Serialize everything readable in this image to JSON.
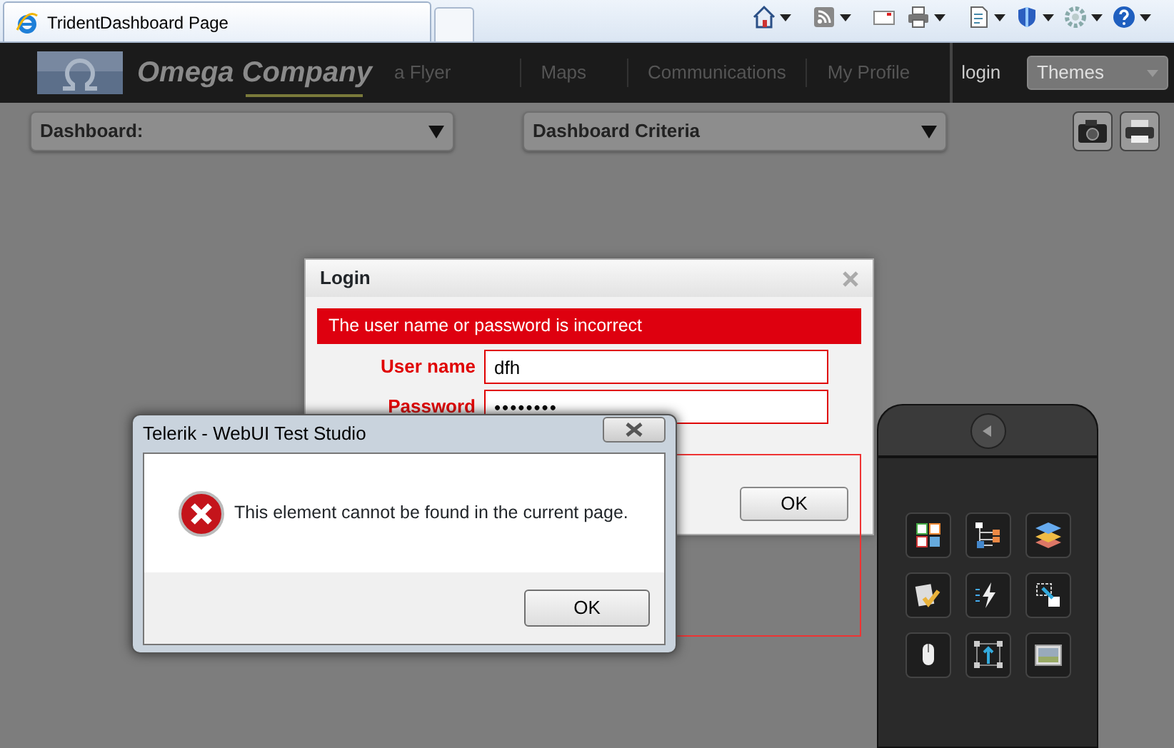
{
  "browser": {
    "tab_title": "TridentDashboard Page"
  },
  "header": {
    "logo": "Omega Company",
    "nav": [
      "a Flyer",
      "Maps",
      "Communications",
      "My Profile"
    ],
    "login": "login",
    "themes": {
      "placeholder": "Themes"
    }
  },
  "toolbar": {
    "dropdowns": [
      "Dashboard:",
      "Dashboard Criteria"
    ]
  },
  "login_dialog": {
    "title": "Login",
    "error": "The user name or password is incorrect",
    "fields": [
      {
        "label": "User name",
        "value": "dfh"
      },
      {
        "label": "Password",
        "value": "••••••••"
      }
    ],
    "button": "OK"
  },
  "message_box": {
    "title": "Telerik - WebUI Test Studio",
    "message": "This element cannot be found in the current page.",
    "button": "OK"
  }
}
